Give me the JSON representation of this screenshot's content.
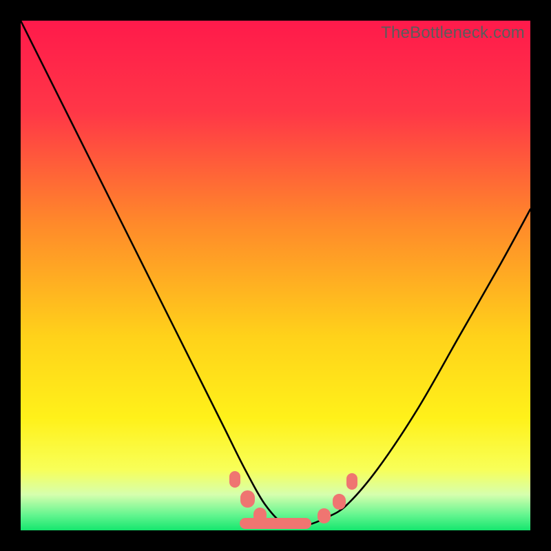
{
  "watermark": "TheBottleneck.com",
  "chart_data": {
    "type": "line",
    "title": "",
    "xlabel": "",
    "ylabel": "",
    "xlim": [
      0,
      100
    ],
    "ylim": [
      0,
      100
    ],
    "gradient_stops": [
      {
        "pos": 0.0,
        "color": "#ff1a4b"
      },
      {
        "pos": 0.18,
        "color": "#ff3747"
      },
      {
        "pos": 0.4,
        "color": "#ff8a2a"
      },
      {
        "pos": 0.62,
        "color": "#ffd21a"
      },
      {
        "pos": 0.78,
        "color": "#fff11a"
      },
      {
        "pos": 0.88,
        "color": "#f8ff58"
      },
      {
        "pos": 0.93,
        "color": "#d6ffae"
      },
      {
        "pos": 0.97,
        "color": "#63f58f"
      },
      {
        "pos": 1.0,
        "color": "#15e66e"
      }
    ],
    "series": [
      {
        "name": "bottleneck-curve",
        "x": [
          0,
          4,
          10,
          16,
          22,
          28,
          34,
          40,
          44,
          48,
          52,
          56,
          60,
          64,
          70,
          78,
          86,
          94,
          100
        ],
        "y": [
          100,
          92,
          80,
          68,
          56,
          44,
          32,
          20,
          12,
          5,
          1,
          1,
          2.5,
          5,
          12,
          24,
          38,
          52,
          63
        ]
      }
    ],
    "markers": {
      "name": "flat-bottom-highlight",
      "points": [
        {
          "x": 42.0,
          "y": 10.0,
          "w": 2.2,
          "h": 3.2
        },
        {
          "x": 44.5,
          "y": 6.2,
          "w": 2.8,
          "h": 3.4
        },
        {
          "x": 47.0,
          "y": 3.0,
          "w": 2.6,
          "h": 3.0
        },
        {
          "x": 50.0,
          "y": 1.4,
          "w": 14.0,
          "h": 2.2
        },
        {
          "x": 59.5,
          "y": 2.8,
          "w": 2.6,
          "h": 3.0
        },
        {
          "x": 62.5,
          "y": 5.6,
          "w": 2.6,
          "h": 3.2
        },
        {
          "x": 65.0,
          "y": 9.6,
          "w": 2.2,
          "h": 3.2
        }
      ]
    }
  }
}
